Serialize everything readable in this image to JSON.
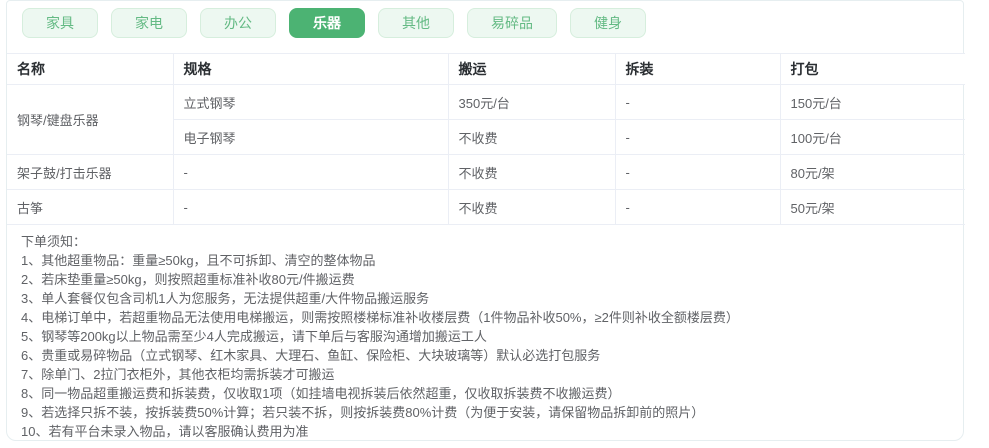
{
  "tabs": {
    "items": [
      {
        "label": "家具",
        "selected": false
      },
      {
        "label": "家电",
        "selected": false
      },
      {
        "label": "办公",
        "selected": false
      },
      {
        "label": "乐器",
        "selected": true
      },
      {
        "label": "其他",
        "selected": false
      },
      {
        "label": "易碎品",
        "selected": false
      },
      {
        "label": "健身",
        "selected": false
      }
    ],
    "selected_tab": "乐器"
  },
  "table": {
    "columns": [
      "名称",
      "规格",
      "搬运",
      "拆装",
      "打包"
    ],
    "rows": [
      {
        "name": "钢琴/键盘乐器",
        "name_rowspan": 2,
        "spec": "立式钢琴",
        "carry": "350元/台",
        "disassembly": "-",
        "pack": "150元/台"
      },
      {
        "name": "",
        "name_rowspan": 0,
        "spec": "电子钢琴",
        "carry": "不收费",
        "disassembly": "-",
        "pack": "100元/台"
      },
      {
        "name": "架子鼓/打击乐器",
        "name_rowspan": 1,
        "spec": "-",
        "carry": "不收费",
        "disassembly": "-",
        "pack": "80元/架"
      },
      {
        "name": "古筝",
        "name_rowspan": 1,
        "spec": "-",
        "carry": "不收费",
        "disassembly": "-",
        "pack": "50元/架"
      }
    ]
  },
  "notes": {
    "title": "下单须知：",
    "items": [
      "1、其他超重物品：重量≥50kg，且不可拆卸、清空的整体物品",
      "2、若床垫重量≥50kg，则按照超重标准补收80元/件搬运费",
      "3、单人套餐仅包含司机1人为您服务，无法提供超重/大件物品搬运服务",
      "4、电梯订单中，若超重物品无法使用电梯搬运，则需按照楼梯标准补收楼层费（1件物品补收50%，≥2件则补收全额楼层费）",
      "5、钢琴等200kg以上物品需至少4人完成搬运，请下单后与客服沟通增加搬运工人",
      "6、贵重或易碎物品（立式钢琴、红木家具、大理石、鱼缸、保险柜、大块玻璃等）默认必选打包服务",
      "7、除单门、2拉门衣柜外，其他衣柜均需拆装才可搬运",
      "8、同一物品超重搬运费和拆装费，仅收取1项（如挂墙电视拆装后依然超重，仅收取拆装费不收搬运费）",
      "9、若选择只拆不装，按拆装费50%计算；若只装不拆，则按拆装费80%计费（为便于安装，请保留物品拆卸前的照片）",
      "10、若有平台未录入物品，请以客服确认费用为准"
    ]
  },
  "colors": {
    "accent_green": "#4cb373",
    "pill_bg": "#edf8f1",
    "pill_border": "#d6eedd",
    "pill_text": "#64ba84",
    "table_border": "#ebeef5",
    "header_text": "#2b2f33",
    "cell_text": "#606266",
    "card_border": "#e6eef0"
  }
}
